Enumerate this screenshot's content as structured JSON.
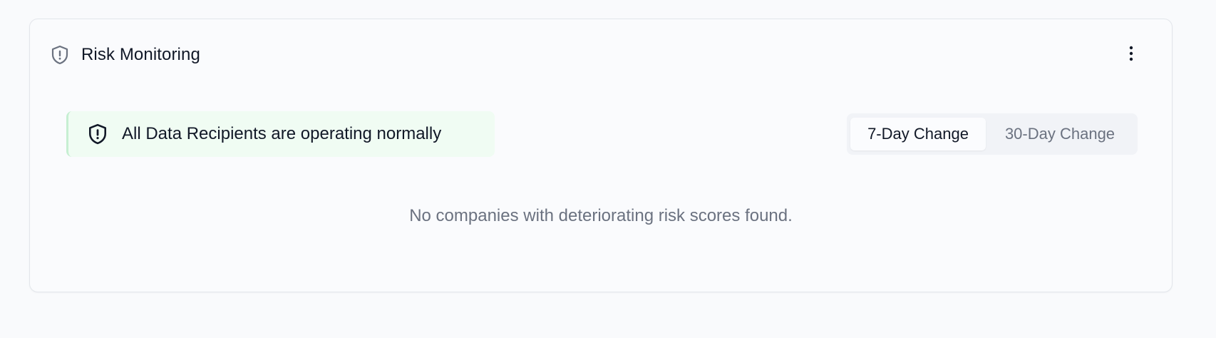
{
  "card": {
    "title": "Risk Monitoring",
    "header_icon": "shield-alert-icon",
    "menu_icon": "more-vertical-icon"
  },
  "status_banner": {
    "icon": "shield-alert-icon",
    "text": "All Data Recipients are operating normally"
  },
  "period_toggle": {
    "options": [
      {
        "label": "7-Day Change",
        "selected": true
      },
      {
        "label": "30-Day Change",
        "selected": false
      }
    ]
  },
  "empty_state": {
    "text": "No companies with deteriorating risk scores found."
  },
  "colors": {
    "page_background": "#f9fafc",
    "banner_background": "#f0fcf3",
    "banner_accent": "#c6efd2",
    "muted_text": "#6b7280",
    "primary_text": "#111827"
  }
}
